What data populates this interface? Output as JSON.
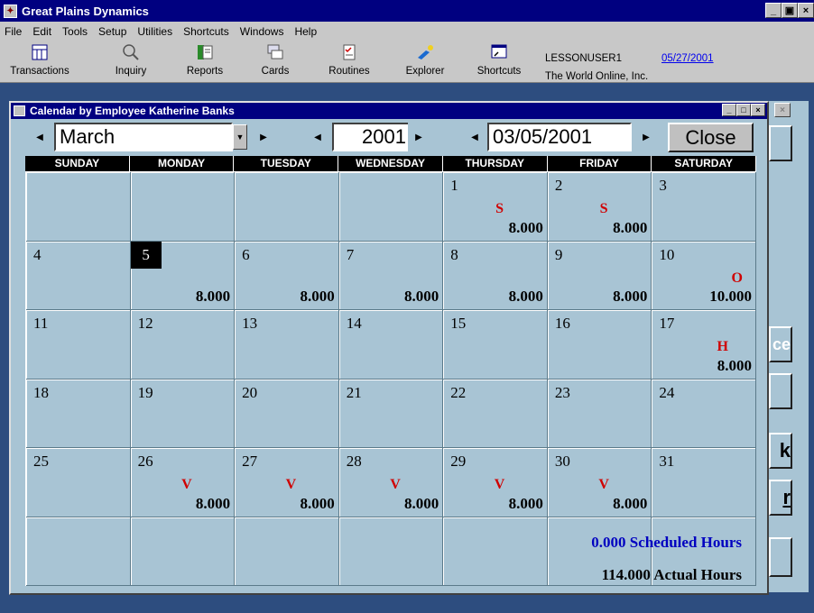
{
  "app": {
    "title": "Great Plains Dynamics"
  },
  "menu": [
    "File",
    "Edit",
    "Tools",
    "Setup",
    "Utilities",
    "Shortcuts",
    "Windows",
    "Help"
  ],
  "toolbar": {
    "buttons": [
      {
        "label": "Transactions",
        "icon": "transactions-icon"
      },
      {
        "label": "Inquiry",
        "icon": "magnifier-icon"
      },
      {
        "label": "Reports",
        "icon": "reports-icon"
      },
      {
        "label": "Cards",
        "icon": "cards-icon"
      },
      {
        "label": "Routines",
        "icon": "routines-icon"
      },
      {
        "label": "Explorer",
        "icon": "explorer-icon"
      },
      {
        "label": "Shortcuts",
        "icon": "shortcuts-icon"
      }
    ],
    "user": "LESSONUSER1",
    "company": "The World Online, Inc.",
    "date": "05/27/2001"
  },
  "window": {
    "title": "Calendar by Employee Katherine Banks",
    "month": "March",
    "year": "2001",
    "date_field": "03/05/2001",
    "close_label": "Close"
  },
  "weekdays": [
    "SUNDAY",
    "MONDAY",
    "TUESDAY",
    "WEDNESDAY",
    "THURSDAY",
    "FRIDAY",
    "SATURDAY"
  ],
  "cells": [
    {
      "day": "",
      "code": "",
      "hours": ""
    },
    {
      "day": "",
      "code": "",
      "hours": ""
    },
    {
      "day": "",
      "code": "",
      "hours": ""
    },
    {
      "day": "",
      "code": "",
      "hours": ""
    },
    {
      "day": "1",
      "code": "S",
      "hours": "8.000"
    },
    {
      "day": "2",
      "code": "S",
      "hours": "8.000"
    },
    {
      "day": "3",
      "code": "",
      "hours": ""
    },
    {
      "day": "4",
      "code": "",
      "hours": ""
    },
    {
      "day": "5",
      "code": "",
      "hours": "8.000",
      "selected": true
    },
    {
      "day": "6",
      "code": "",
      "hours": "8.000"
    },
    {
      "day": "7",
      "code": "",
      "hours": "8.000"
    },
    {
      "day": "8",
      "code": "",
      "hours": "8.000"
    },
    {
      "day": "9",
      "code": "",
      "hours": "8.000"
    },
    {
      "day": "10",
      "code": "O",
      "hours": "10.000"
    },
    {
      "day": "11",
      "code": "",
      "hours": ""
    },
    {
      "day": "12",
      "code": "",
      "hours": ""
    },
    {
      "day": "13",
      "code": "",
      "hours": ""
    },
    {
      "day": "14",
      "code": "",
      "hours": ""
    },
    {
      "day": "15",
      "code": "",
      "hours": ""
    },
    {
      "day": "16",
      "code": "",
      "hours": ""
    },
    {
      "day": "17",
      "code": "H",
      "hours": "8.000"
    },
    {
      "day": "18",
      "code": "",
      "hours": ""
    },
    {
      "day": "19",
      "code": "",
      "hours": ""
    },
    {
      "day": "20",
      "code": "",
      "hours": ""
    },
    {
      "day": "21",
      "code": "",
      "hours": ""
    },
    {
      "day": "22",
      "code": "",
      "hours": ""
    },
    {
      "day": "23",
      "code": "",
      "hours": ""
    },
    {
      "day": "24",
      "code": "",
      "hours": ""
    },
    {
      "day": "25",
      "code": "",
      "hours": ""
    },
    {
      "day": "26",
      "code": "V",
      "hours": "8.000"
    },
    {
      "day": "27",
      "code": "V",
      "hours": "8.000"
    },
    {
      "day": "28",
      "code": "V",
      "hours": "8.000"
    },
    {
      "day": "29",
      "code": "V",
      "hours": "8.000"
    },
    {
      "day": "30",
      "code": "V",
      "hours": "8.000"
    },
    {
      "day": "31",
      "code": "",
      "hours": ""
    }
  ],
  "summary": {
    "scheduled_value": "0.000",
    "scheduled_label": "Scheduled Hours",
    "actual_value": "114.000",
    "actual_label": "Actual Hours"
  },
  "background_buttons": [
    "ce",
    "k",
    "r"
  ],
  "colors": {
    "title_bar": "#000080",
    "window_bg": "#a8c4d4",
    "code_red": "#d00000",
    "scheduled_blue": "#0000c0"
  }
}
